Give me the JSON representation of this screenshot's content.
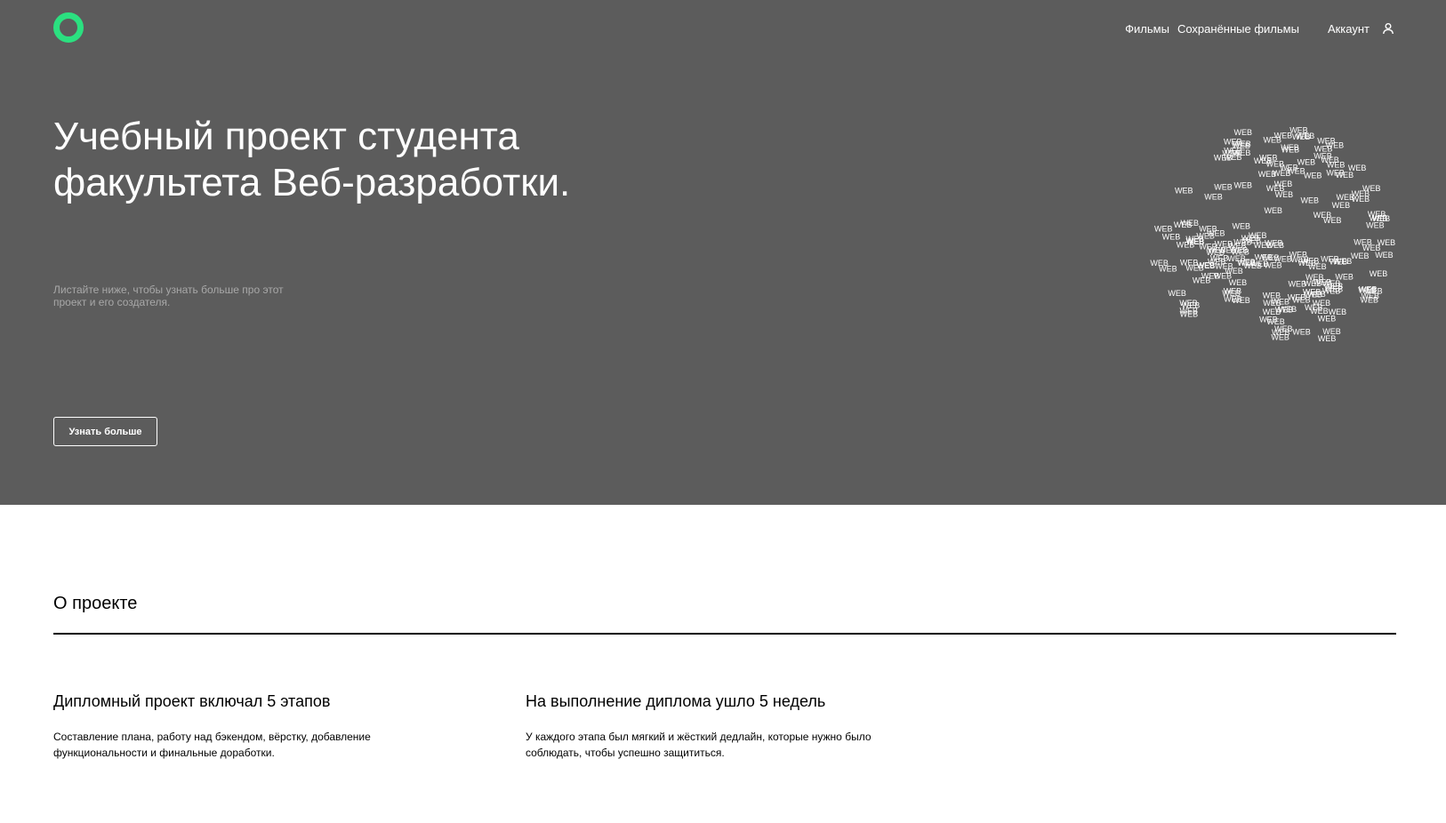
{
  "nav": {
    "films": "Фильмы",
    "saved_films": "Сохранённые фильмы",
    "account": "Аккаунт",
    "account_icon": "user-icon"
  },
  "hero": {
    "title": "Учебный проект студента факультета Веб-разработки.",
    "subtitle": "Листайте ниже, чтобы узнать больше про этот проект и его создателя.",
    "button": "Узнать больше",
    "globe_word": "WEB"
  },
  "about": {
    "title": "О проекте",
    "stages_title": "Дипломный проект включал 5 этапов",
    "stages_text": "Составление плана, работу над бэкендом, вёрстку, добавление функциональности и финальные доработки.",
    "weeks_title": "На выполнение диплома ушло 5 недель",
    "weeks_text": "У каждого этапа был мягкий и жёсткий дедлайн, которые нужно было соблюдать, чтобы успешно защититься."
  },
  "colors": {
    "hero_bg": "#5c5c5c",
    "logo_accent": "#2be080",
    "subtitle": "#a8a8a8"
  }
}
